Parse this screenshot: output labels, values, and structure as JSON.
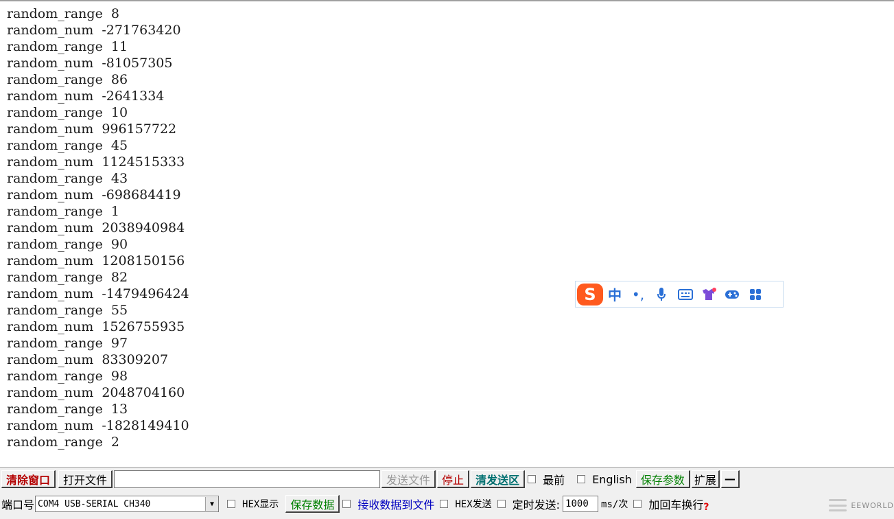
{
  "log_lines": [
    "random_range  8",
    "random_num  -271763420",
    "random_range  11",
    "random_num  -81057305",
    "random_range  86",
    "random_num  -2641334",
    "random_range  10",
    "random_num  996157722",
    "random_range  45",
    "random_num  1124515333",
    "random_range  43",
    "random_num  -698684419",
    "random_range  1",
    "random_num  2038940984",
    "random_range  90",
    "random_num  1208150156",
    "random_range  82",
    "random_num  -1479496424",
    "random_range  55",
    "random_num  1526755935",
    "random_range  97",
    "random_num  83309207",
    "random_range  98",
    "random_num  2048704160",
    "random_range  13",
    "random_num  -1828149410",
    "random_range  2"
  ],
  "ime_toolbar": {
    "logo": "S",
    "mode": "中",
    "punct": "•,",
    "icons": [
      "microphone-icon",
      "keyboard-icon",
      "skin-icon",
      "game-icon",
      "apps-icon"
    ],
    "accent": "#2a6fd6",
    "brand": "#ff5a1f"
  },
  "toolbar_row1": {
    "clear_window": "清除窗口",
    "open_file": "打开文件",
    "file_path_value": "",
    "send_file": "发送文件",
    "stop": "停止",
    "clear_send": "清发送区",
    "topmost": "最前",
    "english": "English",
    "save_params": "保存参数",
    "expand": "扩展",
    "minimize": "—"
  },
  "toolbar_row2": {
    "port_label": "端口号",
    "port_value": "COM4 USB-SERIAL CH340",
    "hex_display": "HEX显示",
    "save_data": "保存数据",
    "recv_to_file": "接收数据到文件",
    "hex_send": "HEX发送",
    "timed_send": "定时发送:",
    "interval_value": "1000",
    "interval_unit": "ms/次",
    "append_crlf": "加回车换行",
    "help": "?"
  },
  "watermark": {
    "text": "EEWORLD"
  },
  "colors": {
    "clear_window": "#b40000",
    "clear_send": "#007070",
    "save": "#008000",
    "disabled": "#9a9a9a"
  }
}
